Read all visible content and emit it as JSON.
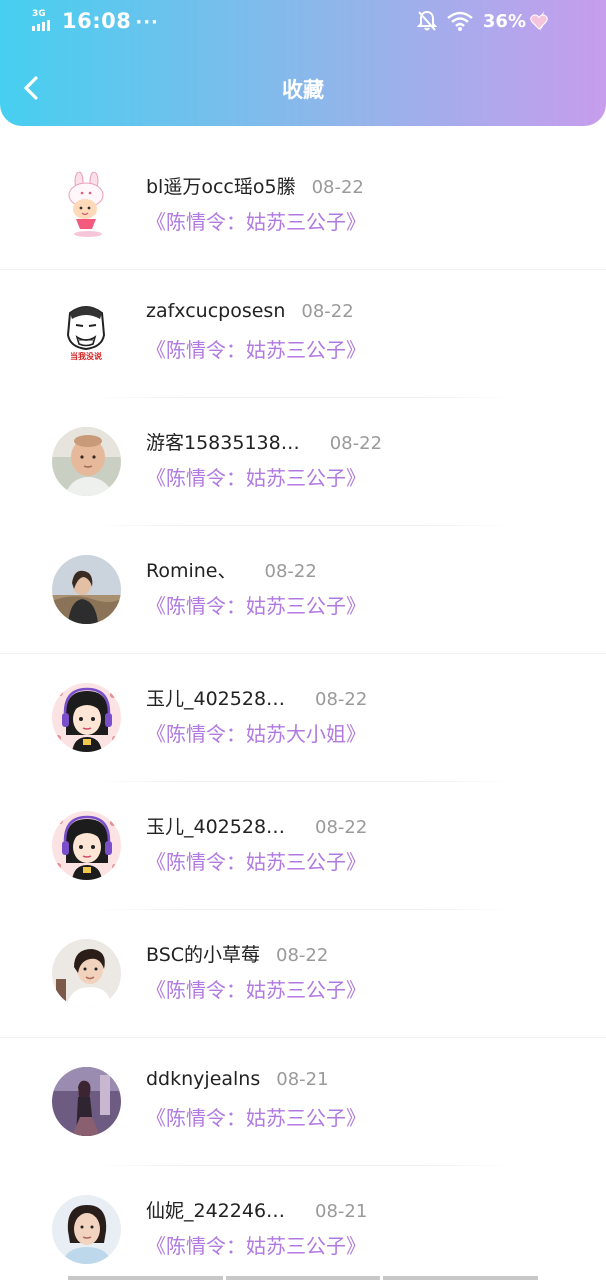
{
  "status_bar": {
    "network": "3G",
    "time": "16:08",
    "more": "···",
    "battery": "36%",
    "icons": [
      "signal-icon",
      "mute-bell-icon",
      "wifi-icon",
      "charging-icon",
      "heart-icon"
    ]
  },
  "header": {
    "title": "收藏",
    "back_icon": "chevron-left-icon"
  },
  "colors": {
    "gradient_start": "#46cff0",
    "gradient_end": "#c79ded",
    "accent_purple": "#b07ae0",
    "name_text": "#222222",
    "date_text": "#9a9a9a"
  },
  "favorites": [
    {
      "name": "bl遥万occ瑶o5縢",
      "date": "08-22",
      "title": "《陈情令：姑苏三公子》",
      "avatar": "cartoon-bunny-girl"
    },
    {
      "name": "zafxcucposesn",
      "date": "08-22",
      "title": "《陈情令：姑苏三公子》",
      "avatar": "meme-face"
    },
    {
      "name": "游客15835138…",
      "date": "08-22",
      "title": "《陈情令：姑苏三公子》",
      "avatar": "baby-photo"
    },
    {
      "name": "Romine、",
      "date": "08-22",
      "title": "《陈情令：姑苏三公子》",
      "avatar": "girl-outdoor-photo"
    },
    {
      "name": "玉儿_402528…",
      "date": "08-22",
      "title": "《陈情令：姑苏大小姐》",
      "avatar": "cartoon-girl-headphones"
    },
    {
      "name": "玉儿_402528…",
      "date": "08-22",
      "title": "《陈情令：姑苏三公子》",
      "avatar": "cartoon-girl-headphones"
    },
    {
      "name": "BSC的小草莓",
      "date": "08-22",
      "title": "《陈情令：姑苏三公子》",
      "avatar": "boy-photo"
    },
    {
      "name": "ddknyjealns",
      "date": "08-21",
      "title": "《陈情令：姑苏三公子》",
      "avatar": "girl-street-photo"
    },
    {
      "name": "仙妮_242246…",
      "date": "08-21",
      "title": "《陈情令：姑苏三公子》",
      "avatar": "woman-portrait-photo"
    }
  ]
}
